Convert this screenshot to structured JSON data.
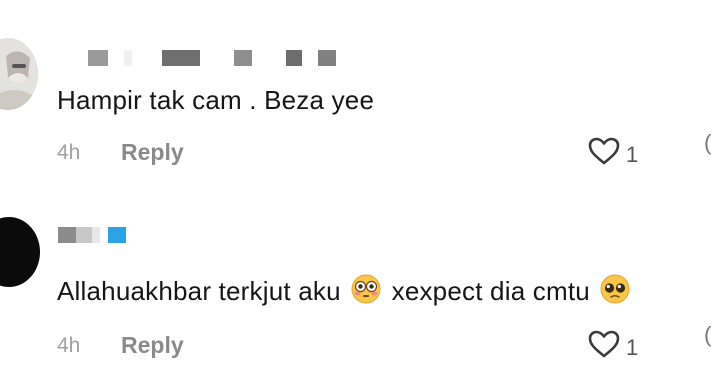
{
  "comments": [
    {
      "text": "Hampir tak cam . Beza yee",
      "time": "4h",
      "reply_label": "Reply",
      "likes": "1",
      "avatar_icon": "user-avatar-photo",
      "username_redacted": true
    },
    {
      "text_before": "Allahuakhbar terkjut aku",
      "text_after": "xexpect dia cmtu",
      "emojis": [
        "flushed-face-emoji",
        "pleading-face-emoji"
      ],
      "time": "4h",
      "reply_label": "Reply",
      "likes": "1",
      "avatar_icon": "user-avatar-black",
      "username_redacted": true
    }
  ],
  "icons": {
    "like": "heart-outline-icon"
  },
  "colors": {
    "text": "#161616",
    "muted": "#a0a0a0",
    "reply": "#8a8a8a",
    "redact_blue": "#29a3e6"
  }
}
